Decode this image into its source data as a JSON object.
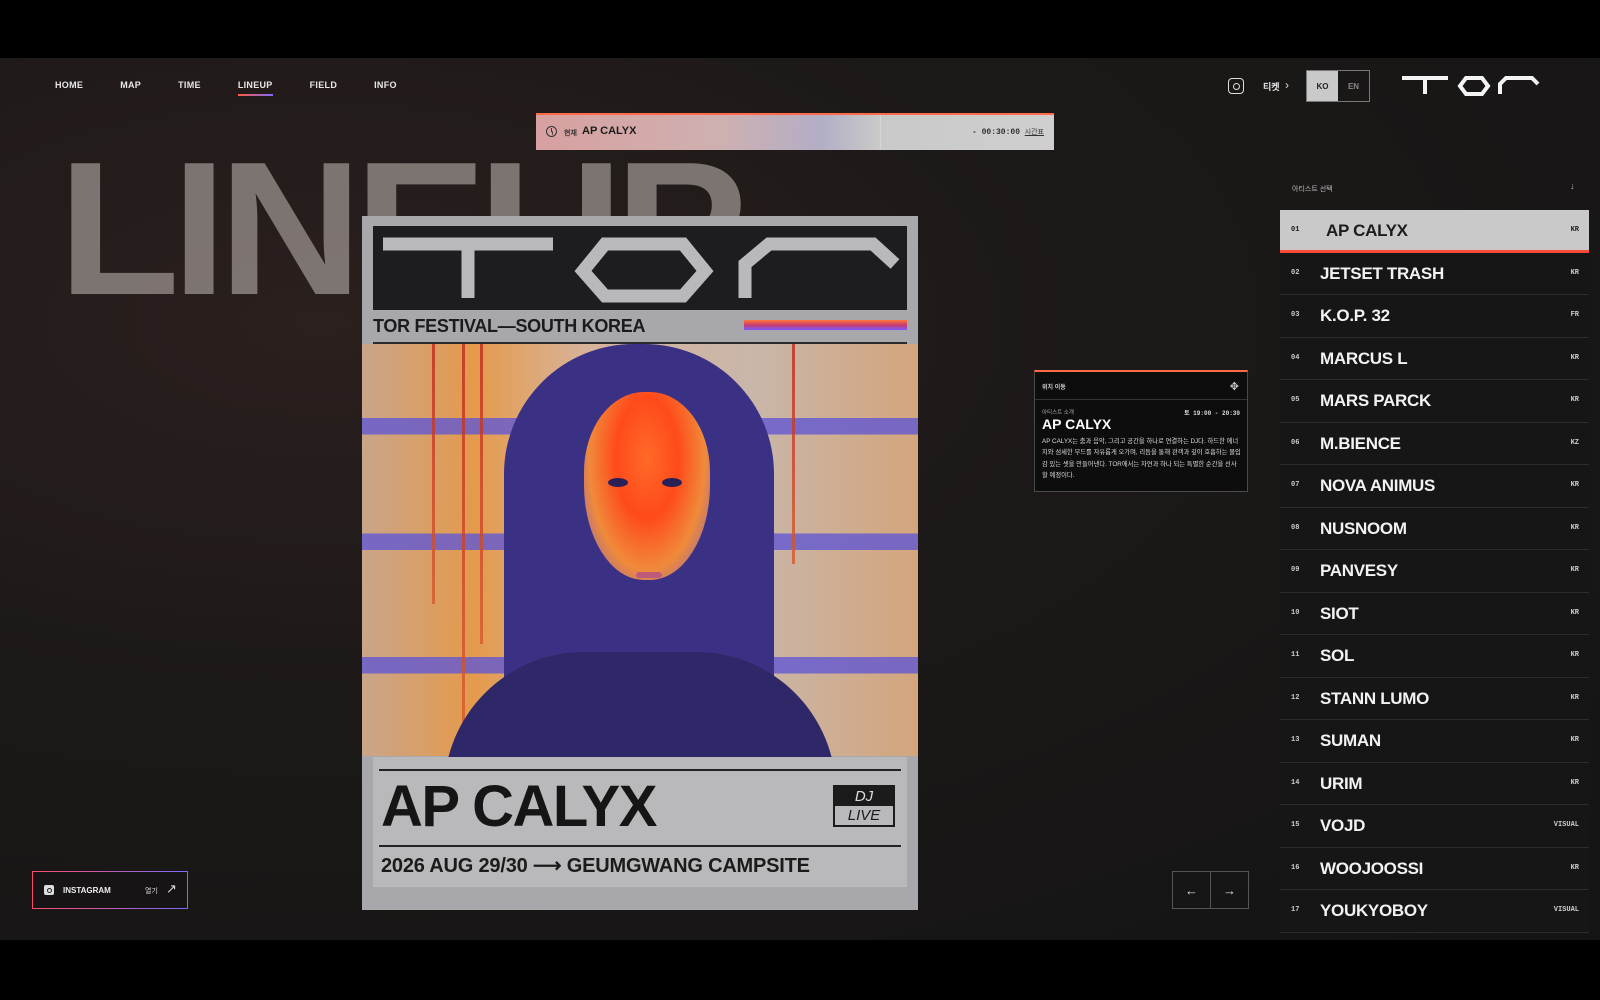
{
  "nav": {
    "items": [
      {
        "label": "HOME"
      },
      {
        "label": "MAP"
      },
      {
        "label": "TIME"
      },
      {
        "label": "LINEUP",
        "active": true
      },
      {
        "label": "FIELD"
      },
      {
        "label": "INFO"
      }
    ]
  },
  "header": {
    "ticket_label": "티켓",
    "lang_ko": "KO",
    "lang_en": "EN",
    "logo_icon": "tor-logo"
  },
  "now_playing": {
    "label": "현재",
    "artist": "AP CALYX",
    "countdown": "- 00:30:00",
    "timetable_link": "시간표"
  },
  "page": {
    "title": "LINEUP"
  },
  "poster": {
    "subtitle": "TOR FESTIVAL—SOUTH KOREA",
    "artist": "AP CALYX",
    "badge_top": "DJ",
    "badge_bottom": "LIVE",
    "date_line": "2026 AUG 29/30 ⟶ GEUMGWANG CAMPSITE"
  },
  "info_panel": {
    "drag_label": "위치 이동",
    "section_label": "아티스트 소개",
    "time": "토 19:00 - 20:30",
    "artist": "AP CALYX",
    "description": "AP CALYX는 춤과 음악, 그리고 공간을 하나로 연결하는 DJ다. 하드한 에너지와 섬세한 무드를 자유롭게 오가며, 리듬을 통해 관객과 깊이 호흡하는 몰입감 있는 셋을 만들어낸다. TOR에서는 자연과 하나 되는 특별한 순간을 선사할 예정이다."
  },
  "artist_list": {
    "header": "아티스트 선택",
    "items": [
      {
        "num": "01",
        "name": "AP CALYX",
        "code": "KR",
        "active": true
      },
      {
        "num": "02",
        "name": "JETSET TRASH",
        "code": "KR"
      },
      {
        "num": "03",
        "name": "K.O.P. 32",
        "code": "FR"
      },
      {
        "num": "04",
        "name": "MARCUS L",
        "code": "KR"
      },
      {
        "num": "05",
        "name": "MARS PARCK",
        "code": "KR"
      },
      {
        "num": "06",
        "name": "M.BIENCE",
        "code": "KZ"
      },
      {
        "num": "07",
        "name": "NOVA ANIMUS",
        "code": "KR"
      },
      {
        "num": "08",
        "name": "NUSNOOM",
        "code": "KR"
      },
      {
        "num": "09",
        "name": "PANVESY",
        "code": "KR"
      },
      {
        "num": "10",
        "name": "SIOT",
        "code": "KR"
      },
      {
        "num": "11",
        "name": "SOL",
        "code": "KR"
      },
      {
        "num": "12",
        "name": "STANN LUMO",
        "code": "KR"
      },
      {
        "num": "13",
        "name": "SUMAN",
        "code": "KR"
      },
      {
        "num": "14",
        "name": "URIM",
        "code": "KR"
      },
      {
        "num": "15",
        "name": "VOJD",
        "code": "VISUAL"
      },
      {
        "num": "16",
        "name": "WOOJOOSSI",
        "code": "KR"
      },
      {
        "num": "17",
        "name": "YOUKYOBOY",
        "code": "VISUAL"
      }
    ]
  },
  "pager": {
    "prev": "←",
    "next": "→"
  },
  "instagram_link": {
    "label": "INSTAGRAM",
    "open": "열기",
    "arrow": "↗"
  },
  "colors": {
    "accent_orange": "#ff6b4a",
    "accent_violet": "#7b6bff",
    "background": "#141414"
  }
}
